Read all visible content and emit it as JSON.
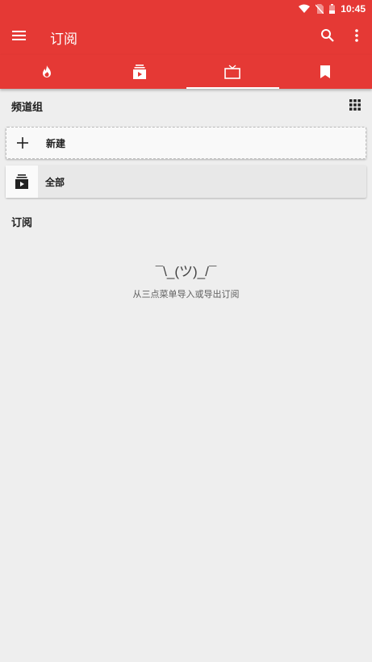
{
  "status_bar": {
    "time": "10:45"
  },
  "toolbar": {
    "title": "订阅"
  },
  "tabs": [
    {
      "icon": "fire-icon"
    },
    {
      "icon": "subscriptions-icon"
    },
    {
      "icon": "tv-icon",
      "selected": true
    },
    {
      "icon": "bookmark-icon"
    }
  ],
  "channel_groups": {
    "header": "频道组",
    "items": [
      {
        "label": "新建",
        "icon": "plus-icon"
      },
      {
        "label": "全部",
        "icon": "subscriptions-icon"
      }
    ]
  },
  "subscriptions": {
    "header": "订阅",
    "empty_face": "¯\\_(ツ)_/¯",
    "empty_hint": "从三点菜单导入或导出订阅"
  },
  "colors": {
    "primary": "#e53935",
    "background": "#eeeeee"
  }
}
